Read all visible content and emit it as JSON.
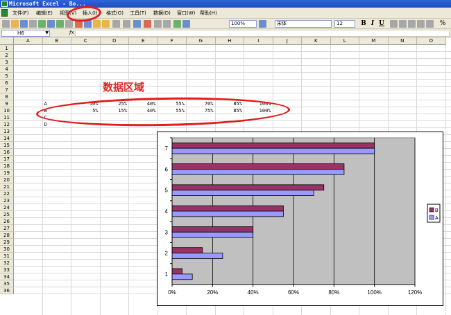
{
  "window": {
    "title": "Microsoft Excel - Bo..."
  },
  "menu": {
    "items": [
      "文件(F)",
      "编辑(E)",
      "视图(V)",
      "插入(I)",
      "格式(O)",
      "工具(T)",
      "数据(D)",
      "窗口(W)",
      "帮助(H)"
    ]
  },
  "toolbar": {
    "zoom": "100%",
    "font_name": "宋体",
    "font_size": "12",
    "bold": "B",
    "italic": "I",
    "underline": "U",
    "percent": "%"
  },
  "formula_bar": {
    "name_box": "H6",
    "fx": "fx",
    "formula": ""
  },
  "sheet": {
    "columns": [
      "A",
      "B",
      "C",
      "D",
      "E",
      "F",
      "G",
      "H",
      "I",
      "J",
      "K",
      "L",
      "M",
      "N",
      "O"
    ],
    "rows": [
      "1",
      "2",
      "3",
      "4",
      "5",
      "6",
      "7",
      "8",
      "9",
      "10",
      "11",
      "12",
      "13",
      "14",
      "15",
      "16",
      "17",
      "18",
      "19",
      "20",
      "21",
      "22",
      "23",
      "24",
      "25",
      "26",
      "27",
      "28",
      "29",
      "30",
      "31",
      "32",
      "33",
      "34",
      "35",
      "36"
    ],
    "row9": {
      "label": "A",
      "values": [
        "10%",
        "25%",
        "40%",
        "55%",
        "70%",
        "85%",
        "100%"
      ]
    },
    "row10": {
      "label": "B",
      "values": [
        "5%",
        "15%",
        "40%",
        "55%",
        "75%",
        "85%",
        "100%"
      ]
    },
    "row11": {
      "label": "C"
    },
    "row12": {
      "label": "D"
    }
  },
  "annotation": {
    "label": "数据区域",
    "color": "#e22525"
  },
  "chart_data": {
    "type": "bar",
    "orientation": "horizontal",
    "categories": [
      "1",
      "2",
      "3",
      "4",
      "5",
      "6",
      "7"
    ],
    "series": [
      {
        "name": "A",
        "values": [
          10,
          25,
          40,
          55,
          70,
          85,
          100
        ],
        "color": "#9999ff"
      },
      {
        "name": "B",
        "values": [
          5,
          15,
          40,
          55,
          75,
          85,
          100
        ],
        "color": "#993366"
      }
    ],
    "xlim": [
      0,
      120
    ],
    "xticks": [
      "0%",
      "20%",
      "40%",
      "60%",
      "80%",
      "100%",
      "120%"
    ],
    "plot_background": "#c0c0c0",
    "grid": true,
    "legend": "right"
  }
}
